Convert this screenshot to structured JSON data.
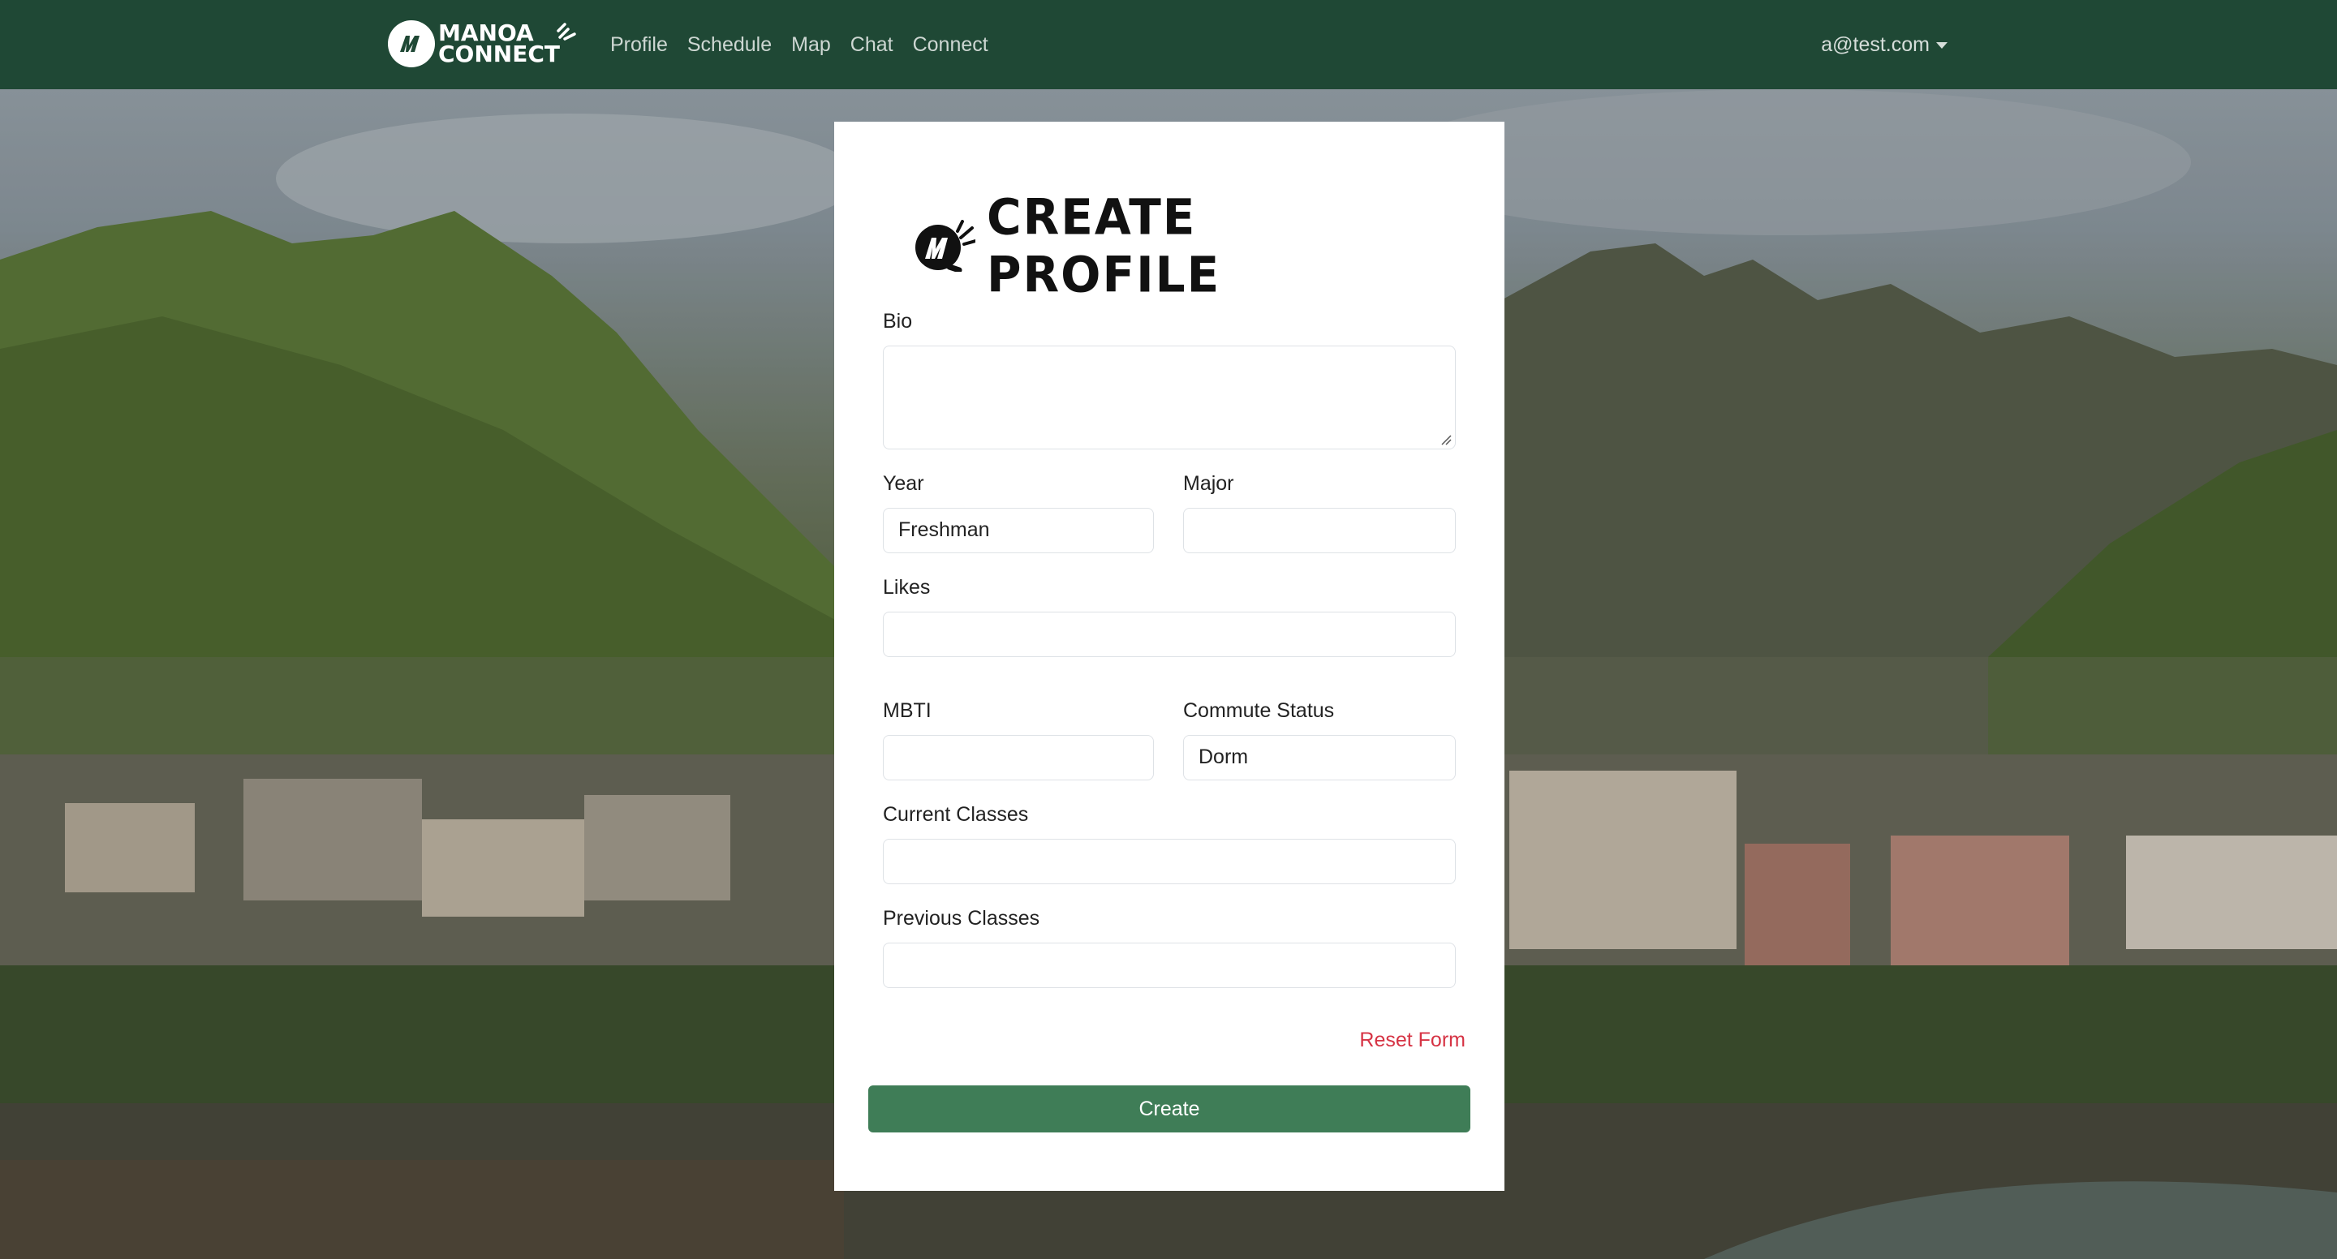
{
  "navbar": {
    "brand": {
      "line1": "MANOA",
      "line2": "CONNECT"
    },
    "links": [
      {
        "label": "Profile"
      },
      {
        "label": "Schedule"
      },
      {
        "label": "Map"
      },
      {
        "label": "Chat"
      },
      {
        "label": "Connect"
      }
    ],
    "user_email": "a@test.com"
  },
  "form": {
    "title": "CREATE PROFILE",
    "fields": {
      "bio": {
        "label": "Bio",
        "value": ""
      },
      "year": {
        "label": "Year",
        "value": "Freshman"
      },
      "major": {
        "label": "Major",
        "value": ""
      },
      "likes": {
        "label": "Likes",
        "value": ""
      },
      "mbti": {
        "label": "MBTI",
        "value": ""
      },
      "commute": {
        "label": "Commute Status",
        "value": "Dorm"
      },
      "current_classes": {
        "label": "Current Classes",
        "value": ""
      },
      "previous_classes": {
        "label": "Previous Classes",
        "value": ""
      }
    },
    "reset_label": "Reset Form",
    "submit_label": "Create"
  },
  "colors": {
    "navbar_bg": "#1f4835",
    "button_bg": "#3f7d57",
    "reset_link": "#d63344"
  },
  "icons": [
    "manoa-connect-logo-icon",
    "caret-down-icon",
    "resize-grip-icon"
  ]
}
